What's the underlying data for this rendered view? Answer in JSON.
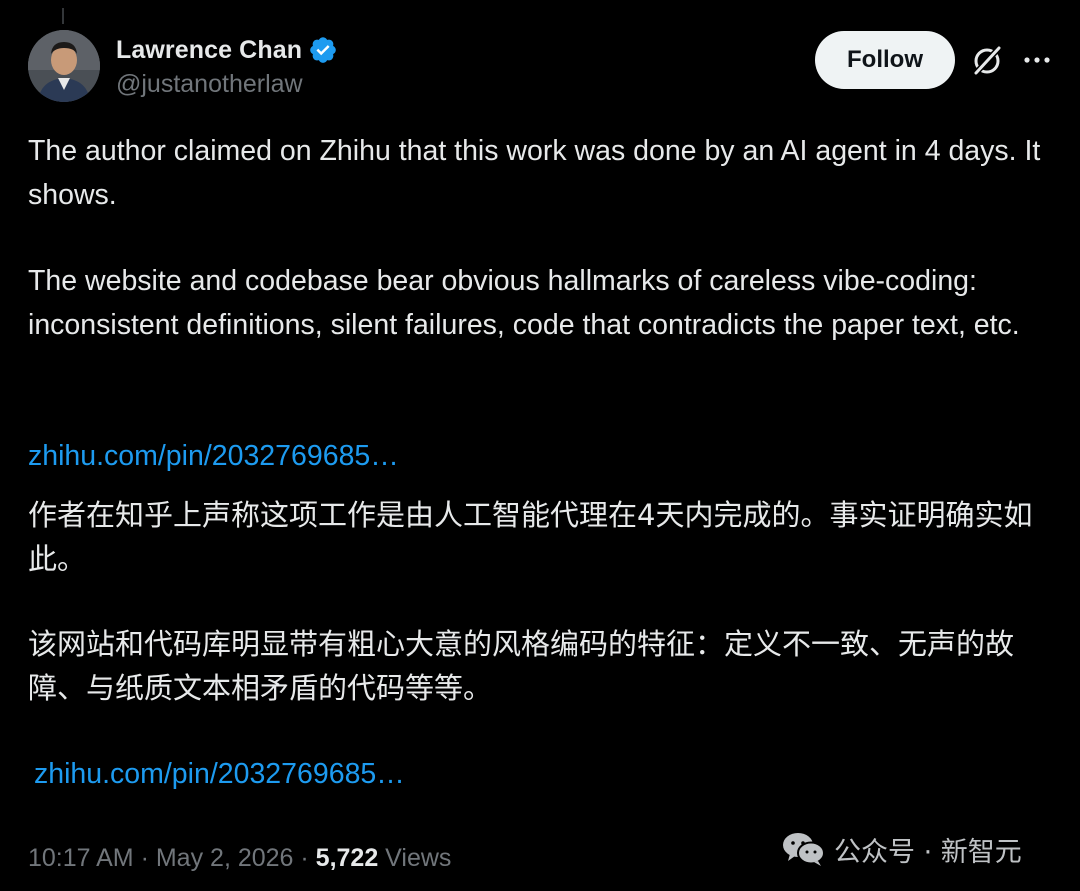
{
  "tweet": {
    "author": {
      "display_name": "Lawrence Chan",
      "handle": "@justanotherlaw",
      "verified": true
    },
    "actions": {
      "follow_label": "Follow",
      "grok_icon": "grok-icon",
      "more_icon": "more-icon"
    },
    "paragraphs": [
      "The author claimed on Zhihu that this work was done by an AI agent in 4 days. It shows.",
      "The website and codebase bear obvious hallmarks of careless vibe-coding: inconsistent definitions, silent failures, code that contradicts the paper text, etc."
    ],
    "link_1": "zhihu.com/pin/2032769685…",
    "translation_paragraphs": [
      "作者在知乎上声称这项工作是由人工智能代理在4天内完成的。事实证明确实如此。",
      "该网站和代码库明显带有粗心大意的风格编码的特征：定义不一致、无声的故障、与纸质文本相矛盾的代码等等。"
    ],
    "link_2": "zhihu.com/pin/2032769685…",
    "meta": {
      "time": "10:17 AM",
      "separator_1": " · ",
      "date": "May 2, 2026",
      "separator_2": " · ",
      "views_count": "5,722",
      "views_label": " Views"
    }
  },
  "watermark": {
    "icon": "wechat-icon",
    "text": "公众号 · 新智元"
  },
  "colors": {
    "background": "#000000",
    "text_primary": "#e7e9ea",
    "text_secondary": "#71767b",
    "link": "#1d9bf0",
    "verified": "#1d9bf0",
    "follow_bg": "#eff3f4"
  }
}
